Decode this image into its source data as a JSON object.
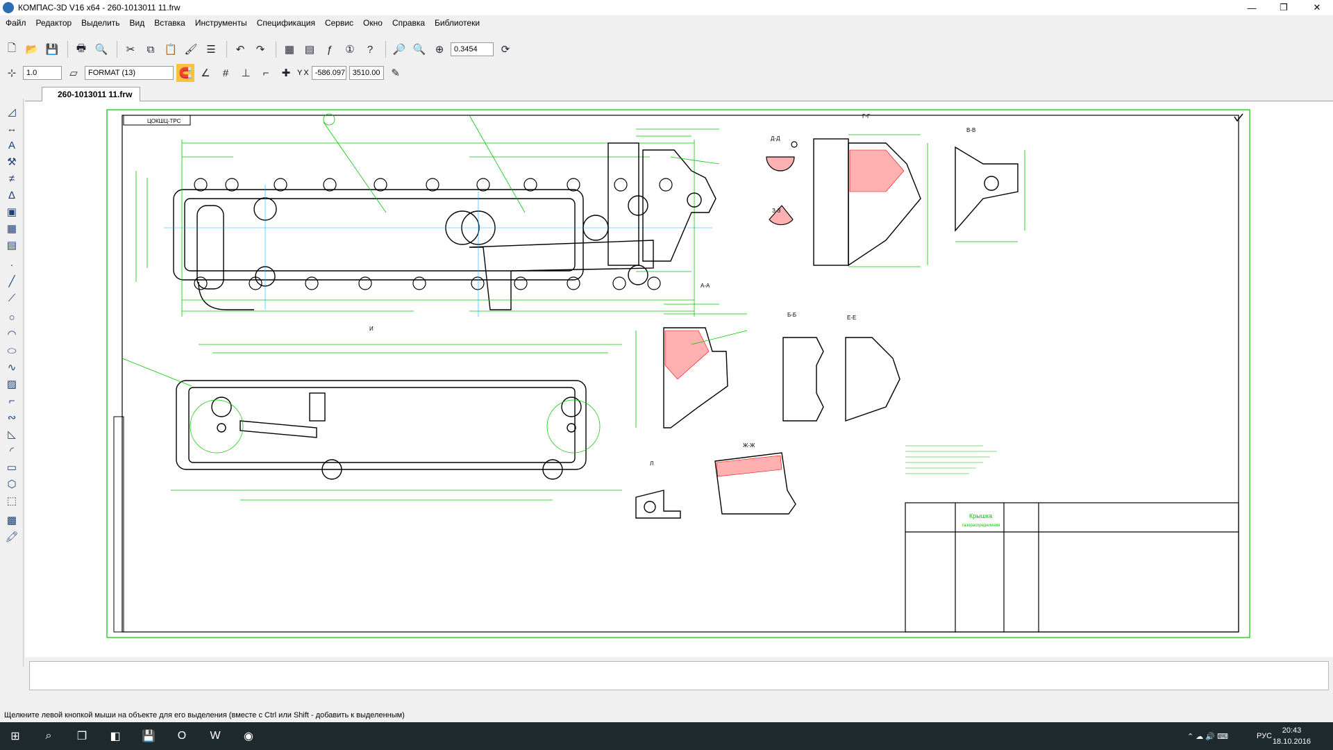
{
  "window": {
    "title": "КОМПАС-3D V16  x64 - 260-1013011   11.frw",
    "minimize": "—",
    "maximize": "❐",
    "close": "✕"
  },
  "menu": [
    "Файл",
    "Редактор",
    "Выделить",
    "Вид",
    "Вставка",
    "Инструменты",
    "Спецификация",
    "Сервис",
    "Окно",
    "Справка",
    "Библиотеки"
  ],
  "toolbar": {
    "zoom_value": "0.3454",
    "scale_value": "1.0",
    "layer_style": "FORMAT (13)",
    "coord_x": "-586.097",
    "coord_y": "3510.00",
    "y_label": "Y",
    "x_label": "X"
  },
  "document": {
    "tab_label": "260-1013011    11.frw"
  },
  "drawing": {
    "stamp_code": "ЦОКШЦ-ТРС",
    "views": {
      "section_aa": "А-А",
      "section_gg": "Г-Г",
      "section_vv": "В-В",
      "section_bb": "Б-Б",
      "section_ee": "Е-Е",
      "section_dd": "Д-Д",
      "section_zhzh": "Ж-Ж",
      "section_zz": "З-З",
      "section_ll": "Л",
      "view_i": "И"
    },
    "title_block": {
      "name": "Крышка",
      "subtitle": "газораспределения"
    }
  },
  "status": {
    "hint": "Щелкните левой кнопкой мыши на объекте для его выделения (вместе с Ctrl или Shift - добавить к выделенным)"
  },
  "taskbar": {
    "lang": "РУС",
    "time": "20:43",
    "date": "18.10.2016"
  },
  "colors": {
    "geometry": "#000000",
    "dimensions": "#00c800",
    "hatch": "#ff0000",
    "aux": "#00b4ff"
  }
}
